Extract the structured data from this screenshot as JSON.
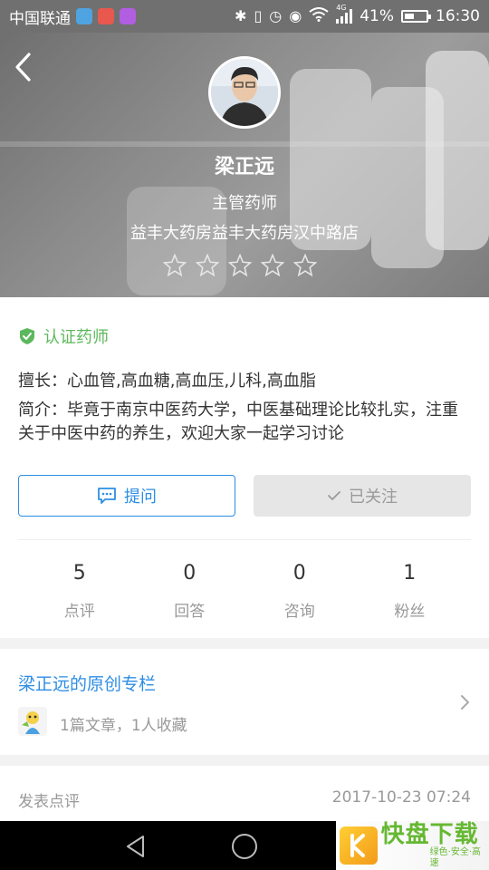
{
  "status_bar": {
    "carrier": "中国联通",
    "network_type": "4G",
    "battery": "41%",
    "time": "16:30"
  },
  "header": {
    "name": "梁正远",
    "title": "主管药师",
    "store": "益丰大药房益丰大药房汉中路店",
    "rating": 0,
    "rating_max": 5
  },
  "profile": {
    "verified_label": "认证药师",
    "specialty": "擅长：心血管,高血糖,高血压,儿科,高血脂",
    "intro": "简介：毕竟于南京中医药大学，中医基础理论比较扎实，注重关于中医中药的养生，欢迎大家一起学习讨论",
    "ask_button": "提问",
    "follow_button": "已关注",
    "stats": [
      {
        "value": "5",
        "label": "点评"
      },
      {
        "value": "0",
        "label": "回答"
      },
      {
        "value": "0",
        "label": "咨询"
      },
      {
        "value": "1",
        "label": "粉丝"
      }
    ]
  },
  "column": {
    "title": "梁正远的原创专栏",
    "stats": "1篇文章，1人收藏"
  },
  "review": {
    "label": "发表点评",
    "time": "2017-10-23 07:24"
  },
  "watermark": {
    "brand": "快盘下载",
    "tagline": "绿色·安全·高速"
  },
  "colors": {
    "accent": "#2d8ee4",
    "verified": "#5cb85c",
    "muted": "#999999"
  }
}
